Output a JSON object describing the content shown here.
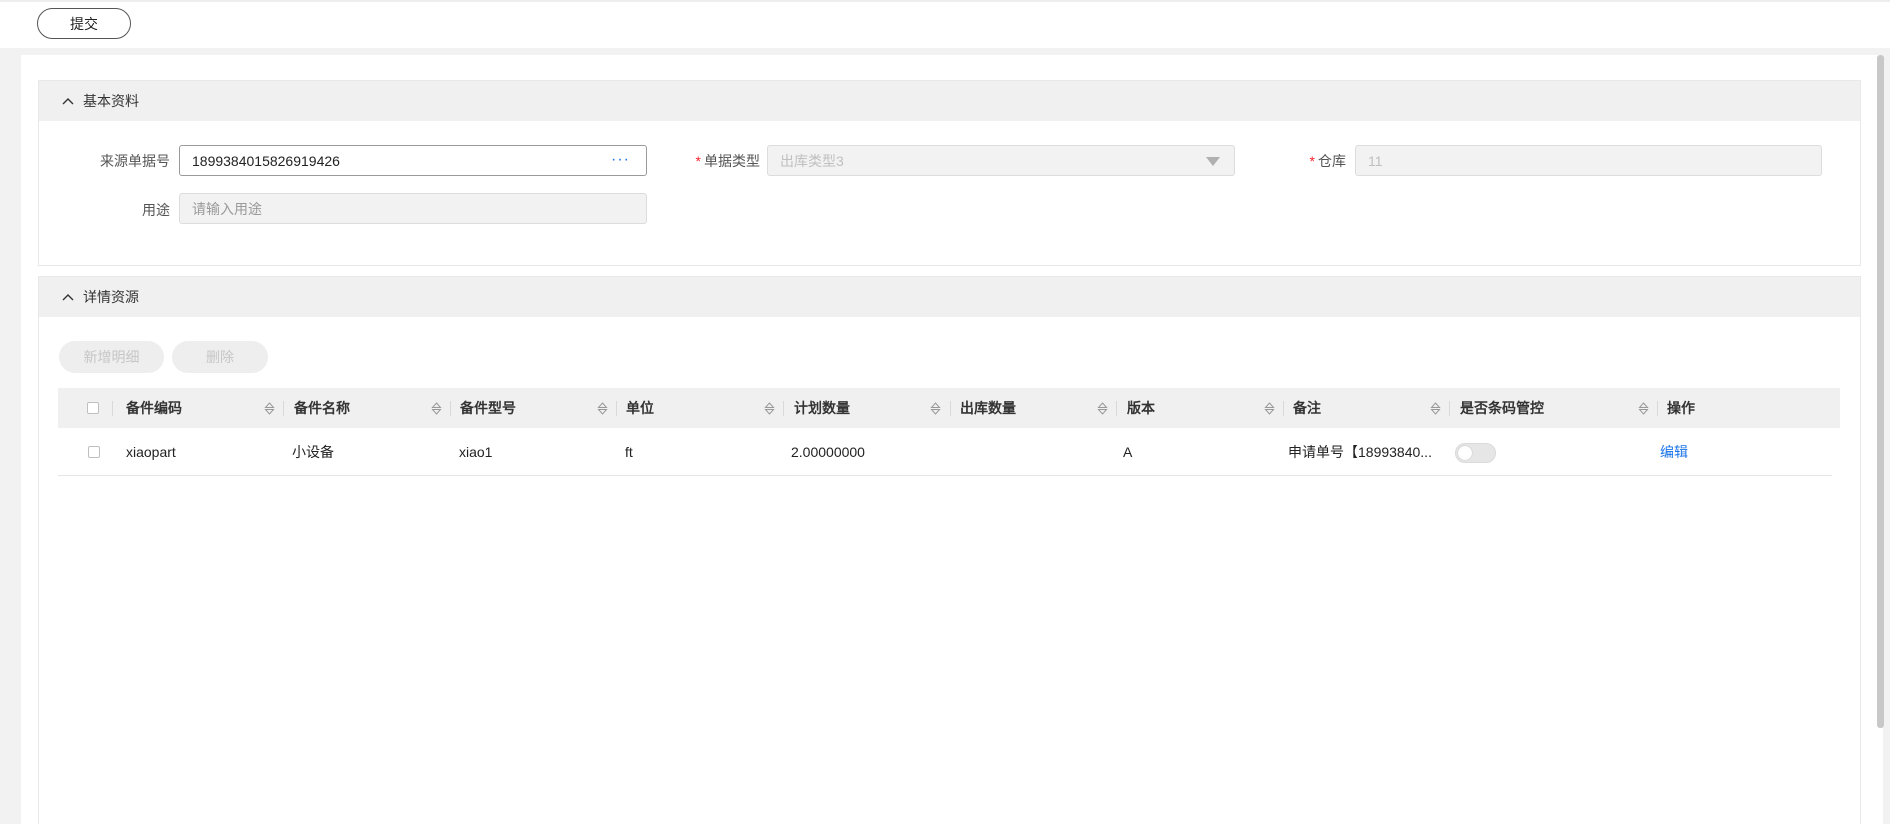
{
  "toolbar": {
    "submit_label": "提交"
  },
  "basic_section": {
    "title": "基本资料",
    "source_no": {
      "label": "来源单据号",
      "value": "1899384015826919426",
      "more": "···"
    },
    "doc_type": {
      "label": "单据类型",
      "value": "出库类型3",
      "required": "*"
    },
    "warehouse": {
      "label": "仓库",
      "value": "11",
      "required": "*"
    },
    "purpose": {
      "label": "用途",
      "placeholder": "请输入用途"
    }
  },
  "detail_section": {
    "title": "详情资源",
    "add_button": "新增明细",
    "delete_button": "删除",
    "columns": [
      "备件编码",
      "备件名称",
      "备件型号",
      "单位",
      "计划数量",
      "出库数量",
      "版本",
      "备注",
      "是否条码管控",
      "操作"
    ],
    "rows": [
      {
        "code": "xiaopart",
        "name": "小设备",
        "model": "xiao1",
        "unit": "ft",
        "planned_qty": "2.00000000",
        "out_qty": "",
        "version": "A",
        "remark": "申请单号【18993840...",
        "barcode_control": false,
        "action": "编辑"
      }
    ]
  },
  "colors": {
    "accent": "#1a73e8",
    "required": "#f5222d",
    "header_bg": "#f0f0f0"
  }
}
